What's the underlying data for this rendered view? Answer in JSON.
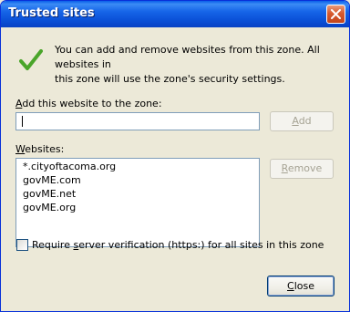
{
  "window": {
    "title": "Trusted sites"
  },
  "icons": {
    "close": "close-icon",
    "check": "checkmark-icon"
  },
  "colors": {
    "titlebar": "#0a4fd6",
    "check": "#4aa52a",
    "close": "#d75a2f"
  },
  "intro": {
    "line1": "You can add and remove websites from this zone. All websites in",
    "line2": "this zone will use the zone's security settings."
  },
  "add_section": {
    "label_prefix": "",
    "label_mnemonic": "A",
    "label_rest": "dd this website to the zone:",
    "input_value": "",
    "add_button": {
      "mnemonic": "A",
      "rest": "dd"
    }
  },
  "websites": {
    "label_prefix": "",
    "label_mnemonic": "W",
    "label_rest": "ebsites:",
    "items": [
      "*.cityoftacoma.org",
      "govME.com",
      "govME.net",
      "govME.org"
    ],
    "remove_button": {
      "mnemonic": "R",
      "rest": "emove"
    }
  },
  "verification": {
    "checked": false,
    "label_prefix": "Require ",
    "label_mnemonic": "s",
    "label_rest": "erver verification (https:) for all sites in this zone"
  },
  "close_button": {
    "mnemonic": "C",
    "rest": "lose"
  }
}
